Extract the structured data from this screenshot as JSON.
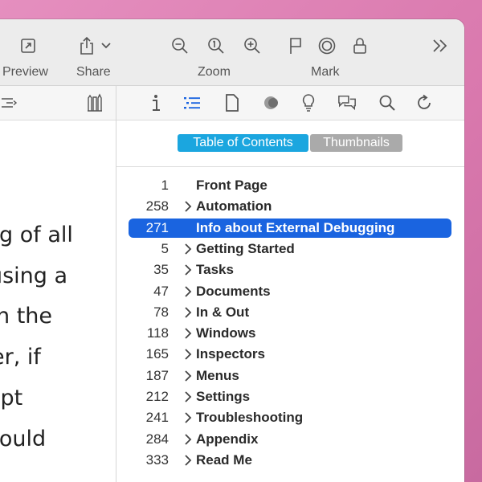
{
  "toolbar": {
    "preview_label": "Preview",
    "share_label": "Share",
    "zoom_label": "Zoom",
    "mark_label": "Mark",
    "icons": [
      "preview-icon",
      "share-icon",
      "chevron-down-icon",
      "zoom-out-icon",
      "actual-size-icon",
      "zoom-in-icon",
      "flag-icon",
      "highlight-icon",
      "lock-icon",
      "more-icon"
    ]
  },
  "sidebar_toolbar": {
    "icons": [
      "list-indent-icon",
      "pencil-cup-icon",
      "info-icon",
      "list-icon",
      "document-icon",
      "tag-icon",
      "lightbulb-icon",
      "comments-icon",
      "search-icon",
      "refresh-icon"
    ]
  },
  "document": {
    "lines": [
      "g of all",
      "using a",
      "n the",
      "er, if",
      "ipt",
      " could"
    ]
  },
  "segmented": {
    "toc_label": "Table of Contents",
    "thumbnails_label": "Thumbnails",
    "selected": "Table of Contents"
  },
  "toc": {
    "items": [
      {
        "page": "1",
        "title": "Front Page",
        "expandable": false
      },
      {
        "page": "258",
        "title": "Automation",
        "expandable": true
      },
      {
        "page": "271",
        "title": "Info about External Debugging",
        "expandable": false,
        "selected": true
      },
      {
        "page": "5",
        "title": "Getting Started",
        "expandable": true
      },
      {
        "page": "35",
        "title": "Tasks",
        "expandable": true
      },
      {
        "page": "47",
        "title": "Documents",
        "expandable": true
      },
      {
        "page": "78",
        "title": "In & Out",
        "expandable": true
      },
      {
        "page": "118",
        "title": "Windows",
        "expandable": true
      },
      {
        "page": "165",
        "title": "Inspectors",
        "expandable": true
      },
      {
        "page": "187",
        "title": "Menus",
        "expandable": true
      },
      {
        "page": "212",
        "title": "Settings",
        "expandable": true
      },
      {
        "page": "241",
        "title": "Troubleshooting",
        "expandable": true
      },
      {
        "page": "284",
        "title": "Appendix",
        "expandable": true
      },
      {
        "page": "333",
        "title": "Read Me",
        "expandable": true
      }
    ]
  },
  "colors": {
    "selection": "#1a64e0",
    "segment_active": "#1ba6df",
    "segment_inactive": "#aaaaaa"
  }
}
